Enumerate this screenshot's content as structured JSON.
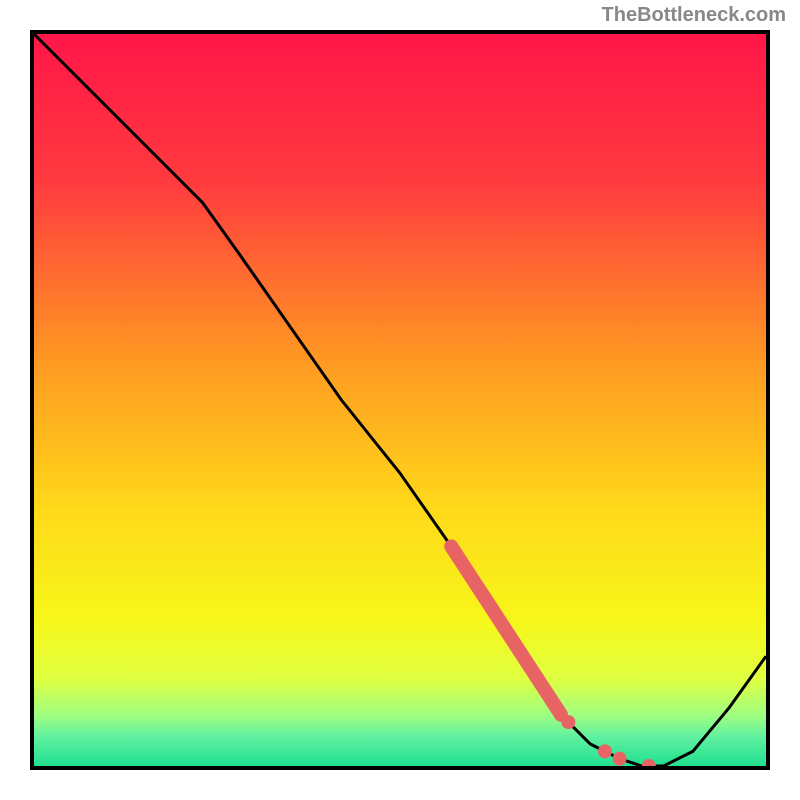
{
  "watermark": "TheBottleneck.com",
  "chart_data": {
    "type": "line",
    "title": "",
    "xlabel": "",
    "ylabel": "",
    "xlim": [
      0,
      100
    ],
    "ylim": [
      0,
      100
    ],
    "series": [
      {
        "name": "curve",
        "x": [
          0,
          5,
          10,
          15,
          20,
          23,
          28,
          35,
          42,
          50,
          57,
          63,
          68,
          72,
          76,
          80,
          83,
          86,
          90,
          95,
          100
        ],
        "y": [
          100,
          95,
          90,
          85,
          80,
          77,
          70,
          60,
          50,
          40,
          30,
          21,
          13,
          7,
          3,
          1,
          0,
          0,
          2,
          8,
          15
        ]
      }
    ],
    "highlight": {
      "segment_x": [
        57,
        72
      ],
      "segment_y": [
        30,
        7
      ],
      "dots": [
        {
          "x": 73,
          "y": 6
        },
        {
          "x": 78,
          "y": 2
        },
        {
          "x": 80,
          "y": 1
        },
        {
          "x": 84,
          "y": 0
        }
      ]
    },
    "gradient": {
      "stops": [
        {
          "offset": 0,
          "color": "#ff1648"
        },
        {
          "offset": 20,
          "color": "#ff3a3f"
        },
        {
          "offset": 45,
          "color": "#ff9a22"
        },
        {
          "offset": 65,
          "color": "#ffd91a"
        },
        {
          "offset": 80,
          "color": "#f7f71a"
        },
        {
          "offset": 88,
          "color": "#e0ff40"
        },
        {
          "offset": 93,
          "color": "#a0ff80"
        },
        {
          "offset": 96,
          "color": "#60f0a0"
        },
        {
          "offset": 100,
          "color": "#20e090"
        }
      ]
    },
    "highlight_color": "#e86464"
  }
}
